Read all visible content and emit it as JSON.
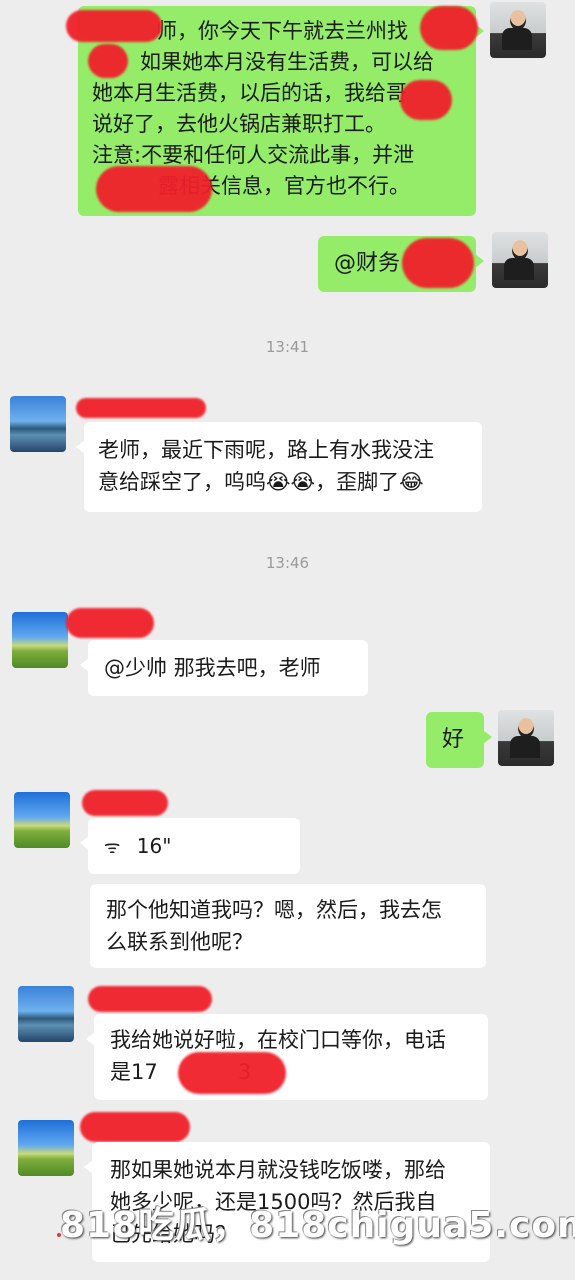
{
  "messages": {
    "m1": {
      "line1": "师，你今天下午就去兰州找",
      "line2": "如果她本月没有生活费，可以给",
      "line3": "她本月生活费，以后的话，我给哥",
      "line4": "说好了，去他火锅店兼职打工。",
      "line5": "注意:不要和任何人交流此事，并泄",
      "line6": "露相关信息，官方也不行。"
    },
    "m2": {
      "text": "@财务"
    },
    "t1": "13:41",
    "m3": {
      "line1": "老师，最近下雨呢，路上有水我没注",
      "line2": "意给踩空了，呜呜😭😭，歪脚了😂"
    },
    "t2": "13:46",
    "m4": {
      "text": "@少帅  那我去吧，老师"
    },
    "m5": {
      "text": "好"
    },
    "m6": {
      "duration": "16\""
    },
    "m7": {
      "line1": "那个他知道我吗？嗯，然后，我去怎",
      "line2": "么联系到他呢？"
    },
    "m8": {
      "line1": "我给她说好啦，在校门口等你，电话",
      "line2": "是17            3"
    },
    "m9": {
      "line1": "那如果她说本月就没钱吃饭喽，那给",
      "line2": "她多少呢，还是1500吗？然后我自",
      "line3": "己先给她吗？"
    }
  },
  "watermark": "818吃瓜，818chigua5.com",
  "colors": {
    "sent_bubble": "#95ec69",
    "received_bubble": "#ffffff",
    "background": "#ededed",
    "redaction": "#f0202a"
  }
}
